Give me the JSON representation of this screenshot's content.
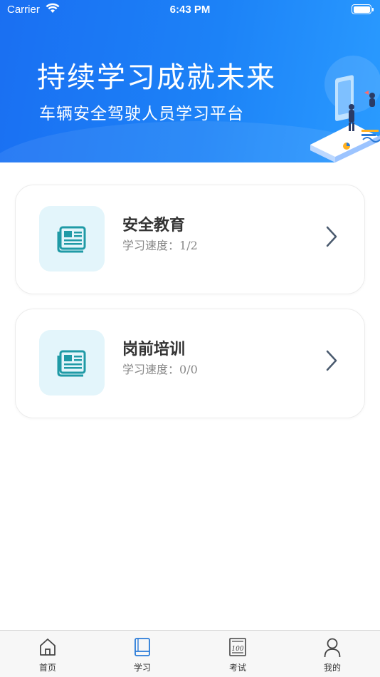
{
  "status_bar": {
    "carrier": "Carrier",
    "time": "6:43 PM"
  },
  "banner": {
    "title": "持续学习成就未来",
    "subtitle": "车辆安全驾驶人员学习平台"
  },
  "courses": [
    {
      "title": "安全教育",
      "progress_label": "学习速度：",
      "progress_value": "1/2",
      "icon": "newspaper-icon"
    },
    {
      "title": "岗前培训",
      "progress_label": "学习速度：",
      "progress_value": "0/0",
      "icon": "newspaper-icon"
    }
  ],
  "tab_bar": {
    "tabs": [
      {
        "label": "首页",
        "icon": "home-icon",
        "active": false
      },
      {
        "label": "学习",
        "icon": "book-icon",
        "active": true
      },
      {
        "label": "考试",
        "icon": "exam-icon",
        "active": false
      },
      {
        "label": "我的",
        "icon": "profile-icon",
        "active": false
      }
    ]
  },
  "colors": {
    "banner_start": "#1a6ff2",
    "banner_end": "#2a9bff",
    "icon_tile": "#e3f5fb",
    "icon_accent": "#1f9aa6",
    "active_tab": "#2a7bd8"
  }
}
